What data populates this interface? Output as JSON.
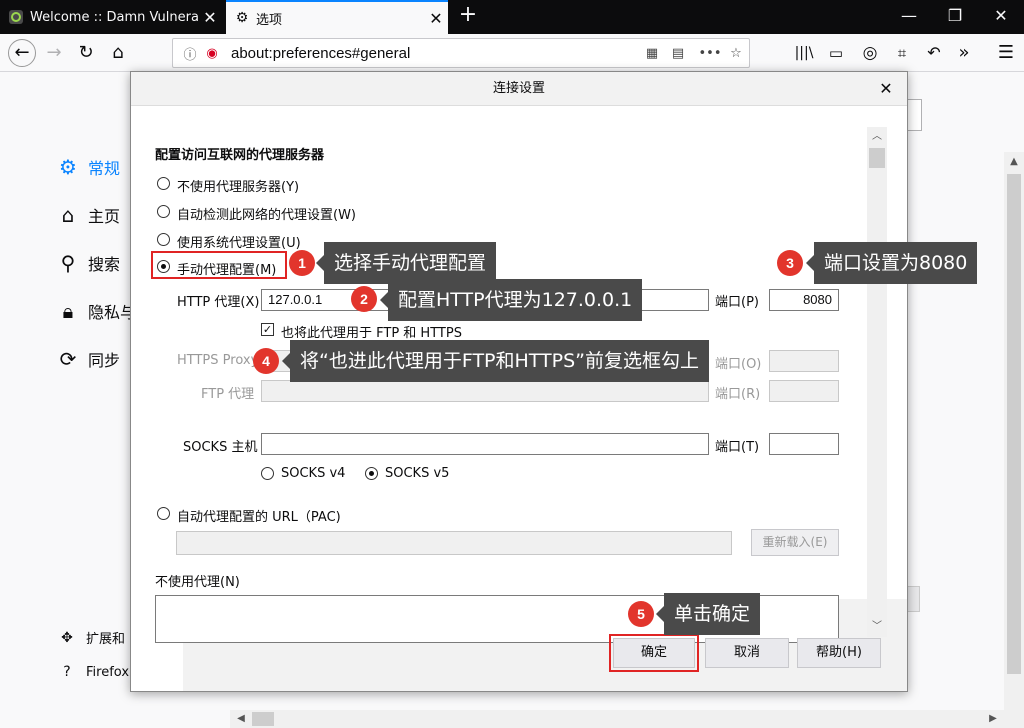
{
  "browser": {
    "tabs": [
      {
        "title": "Welcome :: Damn Vulnerable",
        "icon": "dvwa-favicon-icon"
      },
      {
        "title": "选项",
        "icon": "gear-icon"
      }
    ],
    "url": "about:preferences#general"
  },
  "sidebar": {
    "items": [
      {
        "label": "常规",
        "icon": "gear-icon"
      },
      {
        "label": "主页",
        "icon": "home-icon"
      },
      {
        "label": "搜索",
        "icon": "search-icon"
      },
      {
        "label": "隐私与",
        "icon": "lock-icon"
      },
      {
        "label": "同步",
        "icon": "sync-icon"
      }
    ],
    "bottom": [
      {
        "label": "扩展和",
        "icon": "puzzle-icon"
      },
      {
        "label": "Firefox",
        "icon": "help-icon"
      }
    ]
  },
  "dialog": {
    "title": "连接设置",
    "section_title": "配置访问互联网的代理服务器",
    "options": {
      "no_proxy": "不使用代理服务器(Y)",
      "auto_detect": "自动检测此网络的代理设置(W)",
      "system": "使用系统代理设置(U)",
      "manual": "手动代理配置(M)",
      "pac": "自动代理配置的 URL（PAC)"
    },
    "selected_option": "manual",
    "http": {
      "label": "HTTP 代理(X)",
      "value": "127.0.0.1",
      "port_label": "端口(P)",
      "port": "8080"
    },
    "also_use": {
      "label": "也将此代理用于 FTP 和 HTTPS",
      "checked": true
    },
    "https": {
      "label": "HTTPS Proxy",
      "port_label": "端口(O)"
    },
    "ftp": {
      "label": "FTP 代理",
      "port_label": "端口(R)"
    },
    "socks": {
      "label": "SOCKS 主机",
      "port_label": "端口(T)",
      "v4": "SOCKS v4",
      "v5": "SOCKS v5",
      "selected": "v5"
    },
    "reload_label": "重新载入(E)",
    "no_proxy_for": "不使用代理(N)",
    "buttons": {
      "ok": "确定",
      "cancel": "取消",
      "help": "帮助(H)"
    }
  },
  "annotations": [
    {
      "num": "1",
      "text": "选择手动代理配置"
    },
    {
      "num": "2",
      "text": "配置HTTP代理为127.0.0.1"
    },
    {
      "num": "3",
      "text": "端口设置为8080"
    },
    {
      "num": "4",
      "text": "将“也进此代理用于FTP和HTTPS”前复选框勾上"
    },
    {
      "num": "5",
      "text": "单击确定"
    }
  ],
  "colors": {
    "accent": "#0a84ff",
    "highlight": "#e02424",
    "badge": "#e2352c",
    "callout_bg": "#4a4a4a"
  }
}
